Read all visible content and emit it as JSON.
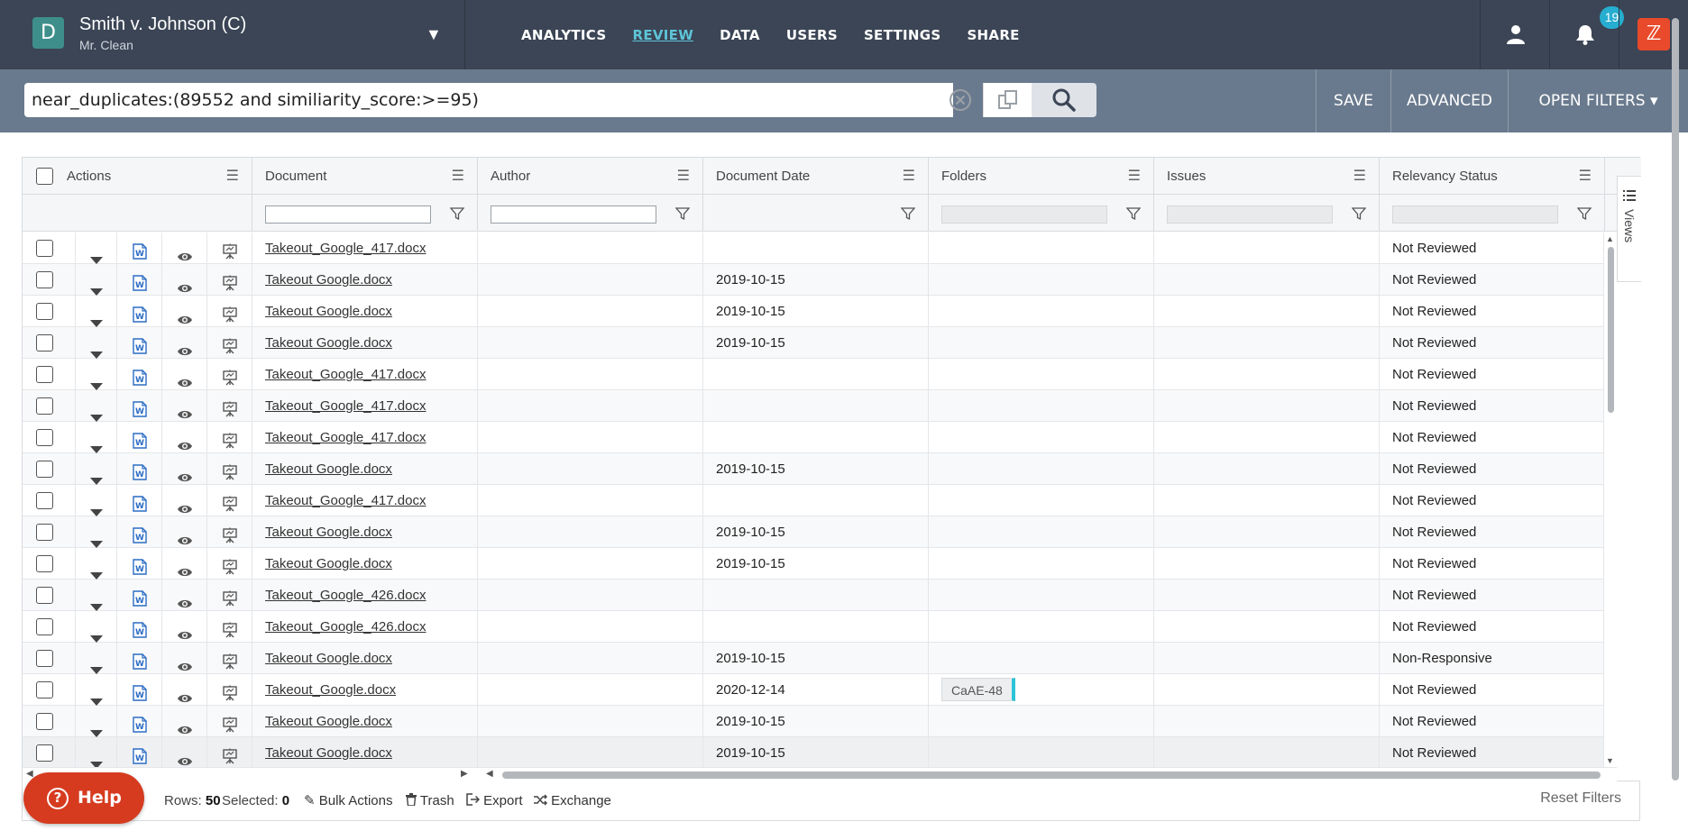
{
  "case": {
    "avatar_letter": "D",
    "title": "Smith v. Johnson (C)",
    "subtitle": "Mr. Clean"
  },
  "nav": [
    {
      "label": "ANALYTICS",
      "active": false
    },
    {
      "label": "REVIEW",
      "active": true
    },
    {
      "label": "DATA",
      "active": false
    },
    {
      "label": "USERS",
      "active": false
    },
    {
      "label": "SETTINGS",
      "active": false
    },
    {
      "label": "SHARE",
      "active": false
    }
  ],
  "notifications": {
    "count": "19"
  },
  "search": {
    "query": "near_duplicates:(89552 and similiarity_score:>=95)"
  },
  "search_actions": {
    "save": "SAVE",
    "advanced": "ADVANCED",
    "open_filters": "OPEN FILTERS ▾"
  },
  "columns": {
    "actions": "Actions",
    "document": "Document",
    "author": "Author",
    "document_date": "Document Date",
    "folders": "Folders",
    "issues": "Issues",
    "relevancy_status": "Relevancy Status"
  },
  "views_tab": "Views",
  "rows": [
    {
      "document": "Takeout_Google_417.docx",
      "author": "",
      "date": "",
      "folder": "",
      "issues": "",
      "status": "Not Reviewed"
    },
    {
      "document": "Takeout Google.docx",
      "author": "",
      "date": "2019-10-15",
      "folder": "",
      "issues": "",
      "status": "Not Reviewed"
    },
    {
      "document": "Takeout Google.docx",
      "author": "",
      "date": "2019-10-15",
      "folder": "",
      "issues": "",
      "status": "Not Reviewed"
    },
    {
      "document": "Takeout Google.docx",
      "author": "",
      "date": "2019-10-15",
      "folder": "",
      "issues": "",
      "status": "Not Reviewed"
    },
    {
      "document": "Takeout_Google_417.docx",
      "author": "",
      "date": "",
      "folder": "",
      "issues": "",
      "status": "Not Reviewed"
    },
    {
      "document": "Takeout_Google_417.docx",
      "author": "",
      "date": "",
      "folder": "",
      "issues": "",
      "status": "Not Reviewed"
    },
    {
      "document": "Takeout_Google_417.docx",
      "author": "",
      "date": "",
      "folder": "",
      "issues": "",
      "status": "Not Reviewed"
    },
    {
      "document": "Takeout Google.docx",
      "author": "",
      "date": "2019-10-15",
      "folder": "",
      "issues": "",
      "status": "Not Reviewed"
    },
    {
      "document": "Takeout_Google_417.docx",
      "author": "",
      "date": "",
      "folder": "",
      "issues": "",
      "status": "Not Reviewed"
    },
    {
      "document": "Takeout Google.docx",
      "author": "",
      "date": "2019-10-15",
      "folder": "",
      "issues": "",
      "status": "Not Reviewed"
    },
    {
      "document": "Takeout Google.docx",
      "author": "",
      "date": "2019-10-15",
      "folder": "",
      "issues": "",
      "status": "Not Reviewed"
    },
    {
      "document": "Takeout_Google_426.docx",
      "author": "",
      "date": "",
      "folder": "",
      "issues": "",
      "status": "Not Reviewed"
    },
    {
      "document": "Takeout_Google_426.docx",
      "author": "",
      "date": "",
      "folder": "",
      "issues": "",
      "status": "Not Reviewed"
    },
    {
      "document": "Takeout Google.docx",
      "author": "",
      "date": "2019-10-15",
      "folder": "",
      "issues": "",
      "status": "Non-Responsive"
    },
    {
      "document": "Takeout_Google.docx",
      "author": "",
      "date": "2020-12-14",
      "folder": "CaAE-48",
      "issues": "",
      "status": "Not Reviewed"
    },
    {
      "document": "Takeout Google.docx",
      "author": "",
      "date": "2019-10-15",
      "folder": "",
      "issues": "",
      "status": "Not Reviewed"
    },
    {
      "document": "Takeout Google.docx",
      "author": "",
      "date": "2019-10-15",
      "folder": "",
      "issues": "",
      "status": "Not Reviewed"
    }
  ],
  "footer": {
    "help": "Help",
    "rows_label": "Rows:",
    "rows_value": "50",
    "selected_label": "Selected:",
    "selected_value": "0",
    "bulk_actions": "Bulk Actions",
    "trash": "Trash",
    "export": "Export",
    "exchange": "Exchange",
    "reset_filters": "Reset Filters"
  },
  "colors": {
    "nav_bg": "#3b4555",
    "search_bg": "#6a7a8e",
    "accent": "#5ec4d8",
    "help": "#d63b1f",
    "word_icon": "#2b6cc4"
  }
}
